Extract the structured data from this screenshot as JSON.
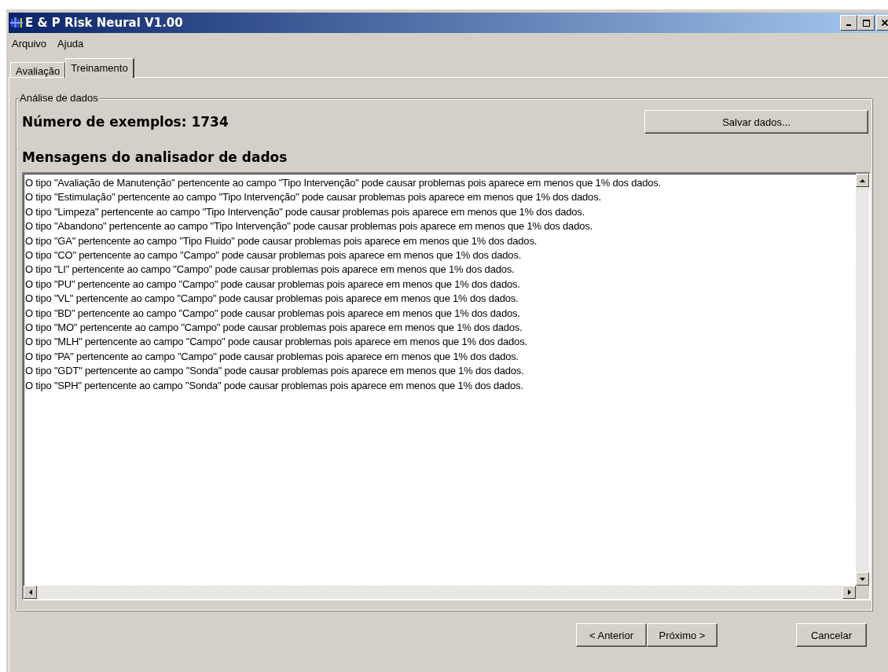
{
  "window": {
    "title": "E & P Risk Neural V1.00"
  },
  "menu": [
    "Arquivo",
    "Ajuda"
  ],
  "tabs": [
    {
      "label": "Avaliação",
      "selected": false
    },
    {
      "label": "Treinamento",
      "selected": true
    }
  ],
  "group": {
    "legend": "Análise de dados",
    "example_count": "Número de exemplos: 1734",
    "save_button": "Salvar dados...",
    "messages_heading": "Mensagens do analisador de dados",
    "messages": [
      "O tipo \"Avaliação de Manutenção\" pertencente ao campo \"Tipo Intervenção\" pode causar problemas pois aparece em menos que 1% dos dados.",
      "O tipo \"Estimulação\" pertencente ao campo \"Tipo Intervenção\" pode causar problemas pois aparece em menos que 1% dos dados.",
      "O tipo \"Limpeza\" pertencente ao campo \"Tipo Intervenção\" pode causar problemas pois aparece em menos que 1% dos dados.",
      "O tipo \"Abandono\" pertencente ao campo \"Tipo Intervenção\" pode causar problemas pois aparece em menos que 1% dos dados.",
      "O tipo \"GA\" pertencente ao campo \"Tipo Fluido\" pode causar problemas pois aparece em menos que 1% dos dados.",
      "O tipo \"CO\" pertencente ao campo \"Campo\" pode causar problemas pois aparece em menos que 1% dos dados.",
      "O tipo \"LI\" pertencente ao campo \"Campo\" pode causar problemas pois aparece em menos que 1% dos dados.",
      "O tipo \"PU\" pertencente ao campo \"Campo\" pode causar problemas pois aparece em menos que 1% dos dados.",
      "O tipo \"VL\" pertencente ao campo \"Campo\" pode causar problemas pois aparece em menos que 1% dos dados.",
      "O tipo \"BD\" pertencente ao campo \"Campo\" pode causar problemas pois aparece em menos que 1% dos dados.",
      "O tipo \"MO\" pertencente ao campo \"Campo\" pode causar problemas pois aparece em menos que 1% dos dados.",
      "O tipo \"MLH\" pertencente ao campo \"Campo\" pode causar problemas pois aparece em menos que 1% dos dados.",
      "O tipo \"PA\" pertencente ao campo \"Campo\" pode causar problemas pois aparece em menos que 1% dos dados.",
      "O tipo \"GDT\" pertencente ao campo \"Sonda\" pode causar problemas pois aparece em menos que 1% dos dados.",
      "O tipo \"SPH\" pertencente ao campo \"Sonda\" pode causar problemas pois aparece em menos que 1% dos dados."
    ]
  },
  "buttons": [
    "< Anterior",
    "Próximo >",
    "Cancelar"
  ]
}
